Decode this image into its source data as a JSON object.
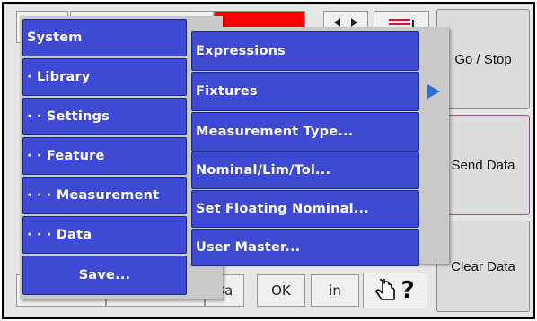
{
  "sidebar": {
    "go_stop": "Go / Stop",
    "send_data": "Send Data",
    "clear_data": "Clear Data"
  },
  "toolbar_bottom": {
    "btn_3a": "3a",
    "btn_ok": "OK",
    "btn_in": "in",
    "help_label": "?"
  },
  "menu_left": [
    "System",
    "· Library",
    "· · Settings",
    "· · Feature",
    "· · · Measurement",
    "· · · Data",
    "Save..."
  ],
  "menu_right": [
    "Expressions",
    "Fixtures",
    "Measurement Type...",
    "Nominal/Lim/Tol...",
    "Set Floating Nominal...",
    "User Master..."
  ],
  "colors": {
    "menu_item": "#3e49d4",
    "status_red": "#ff0000",
    "submenu_arrow": "#2a6fd6"
  },
  "icons": {
    "submenu_arrow": "triangle-right",
    "help": "hand-question"
  }
}
